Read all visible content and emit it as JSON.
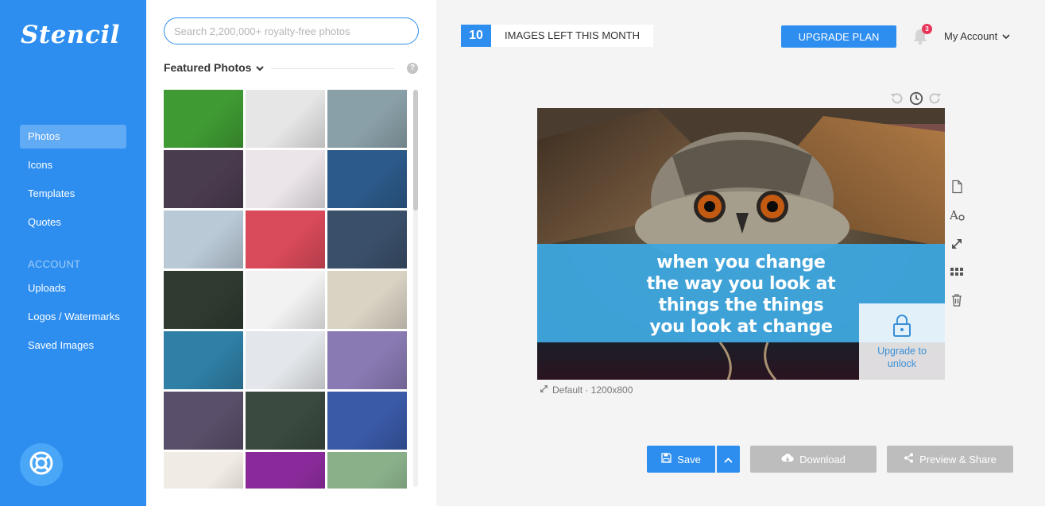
{
  "app": {
    "logo": "Stencil"
  },
  "sidebar": {
    "items": [
      {
        "label": "Photos",
        "active": true
      },
      {
        "label": "Icons"
      },
      {
        "label": "Templates"
      },
      {
        "label": "Quotes"
      }
    ],
    "account_heading": "ACCOUNT",
    "account_items": [
      {
        "label": "Uploads"
      },
      {
        "label": "Logos / Watermarks"
      },
      {
        "label": "Saved Images"
      }
    ],
    "help_icon": "lifebuoy-icon"
  },
  "photos_panel": {
    "search_placeholder": "Search 2,200,000+ royalty-free photos",
    "section_title": "Featured Photos",
    "help_glyph": "?",
    "thumbnail_colors": [
      "#3f9a33",
      "#e6e6e6",
      "#8aa0a8",
      "#4a3c4f",
      "#ebe5ea",
      "#2c5a8a",
      "#b9c9d6",
      "#d94a5a",
      "#3a4f6a",
      "#2f3a30",
      "#f2f2f2",
      "#d9d3c4",
      "#2f7fa6",
      "#e3e6ea",
      "#8a7ab3",
      "#5a4f6a",
      "#3a4a40",
      "#3a5aa8",
      "#f0ebe4",
      "#8a2a9a",
      "#8ab08a"
    ]
  },
  "topbar": {
    "images_left_count": "10",
    "images_left_label": "IMAGES LEFT THIS MONTH",
    "upgrade_label": "UPGRADE PLAN",
    "notification_count": "3",
    "account_label": "My Account"
  },
  "canvas": {
    "quote_lines": [
      "when you change",
      "the way you look at",
      "things the things",
      "you look at change"
    ],
    "band_color": "#3da6de",
    "lock_label_line1": "Upgrade to",
    "lock_label_line2": "unlock",
    "size_info": "Default · 1200x800"
  },
  "actions": {
    "save_label": "Save",
    "download_label": "Download",
    "share_label": "Preview & Share"
  }
}
